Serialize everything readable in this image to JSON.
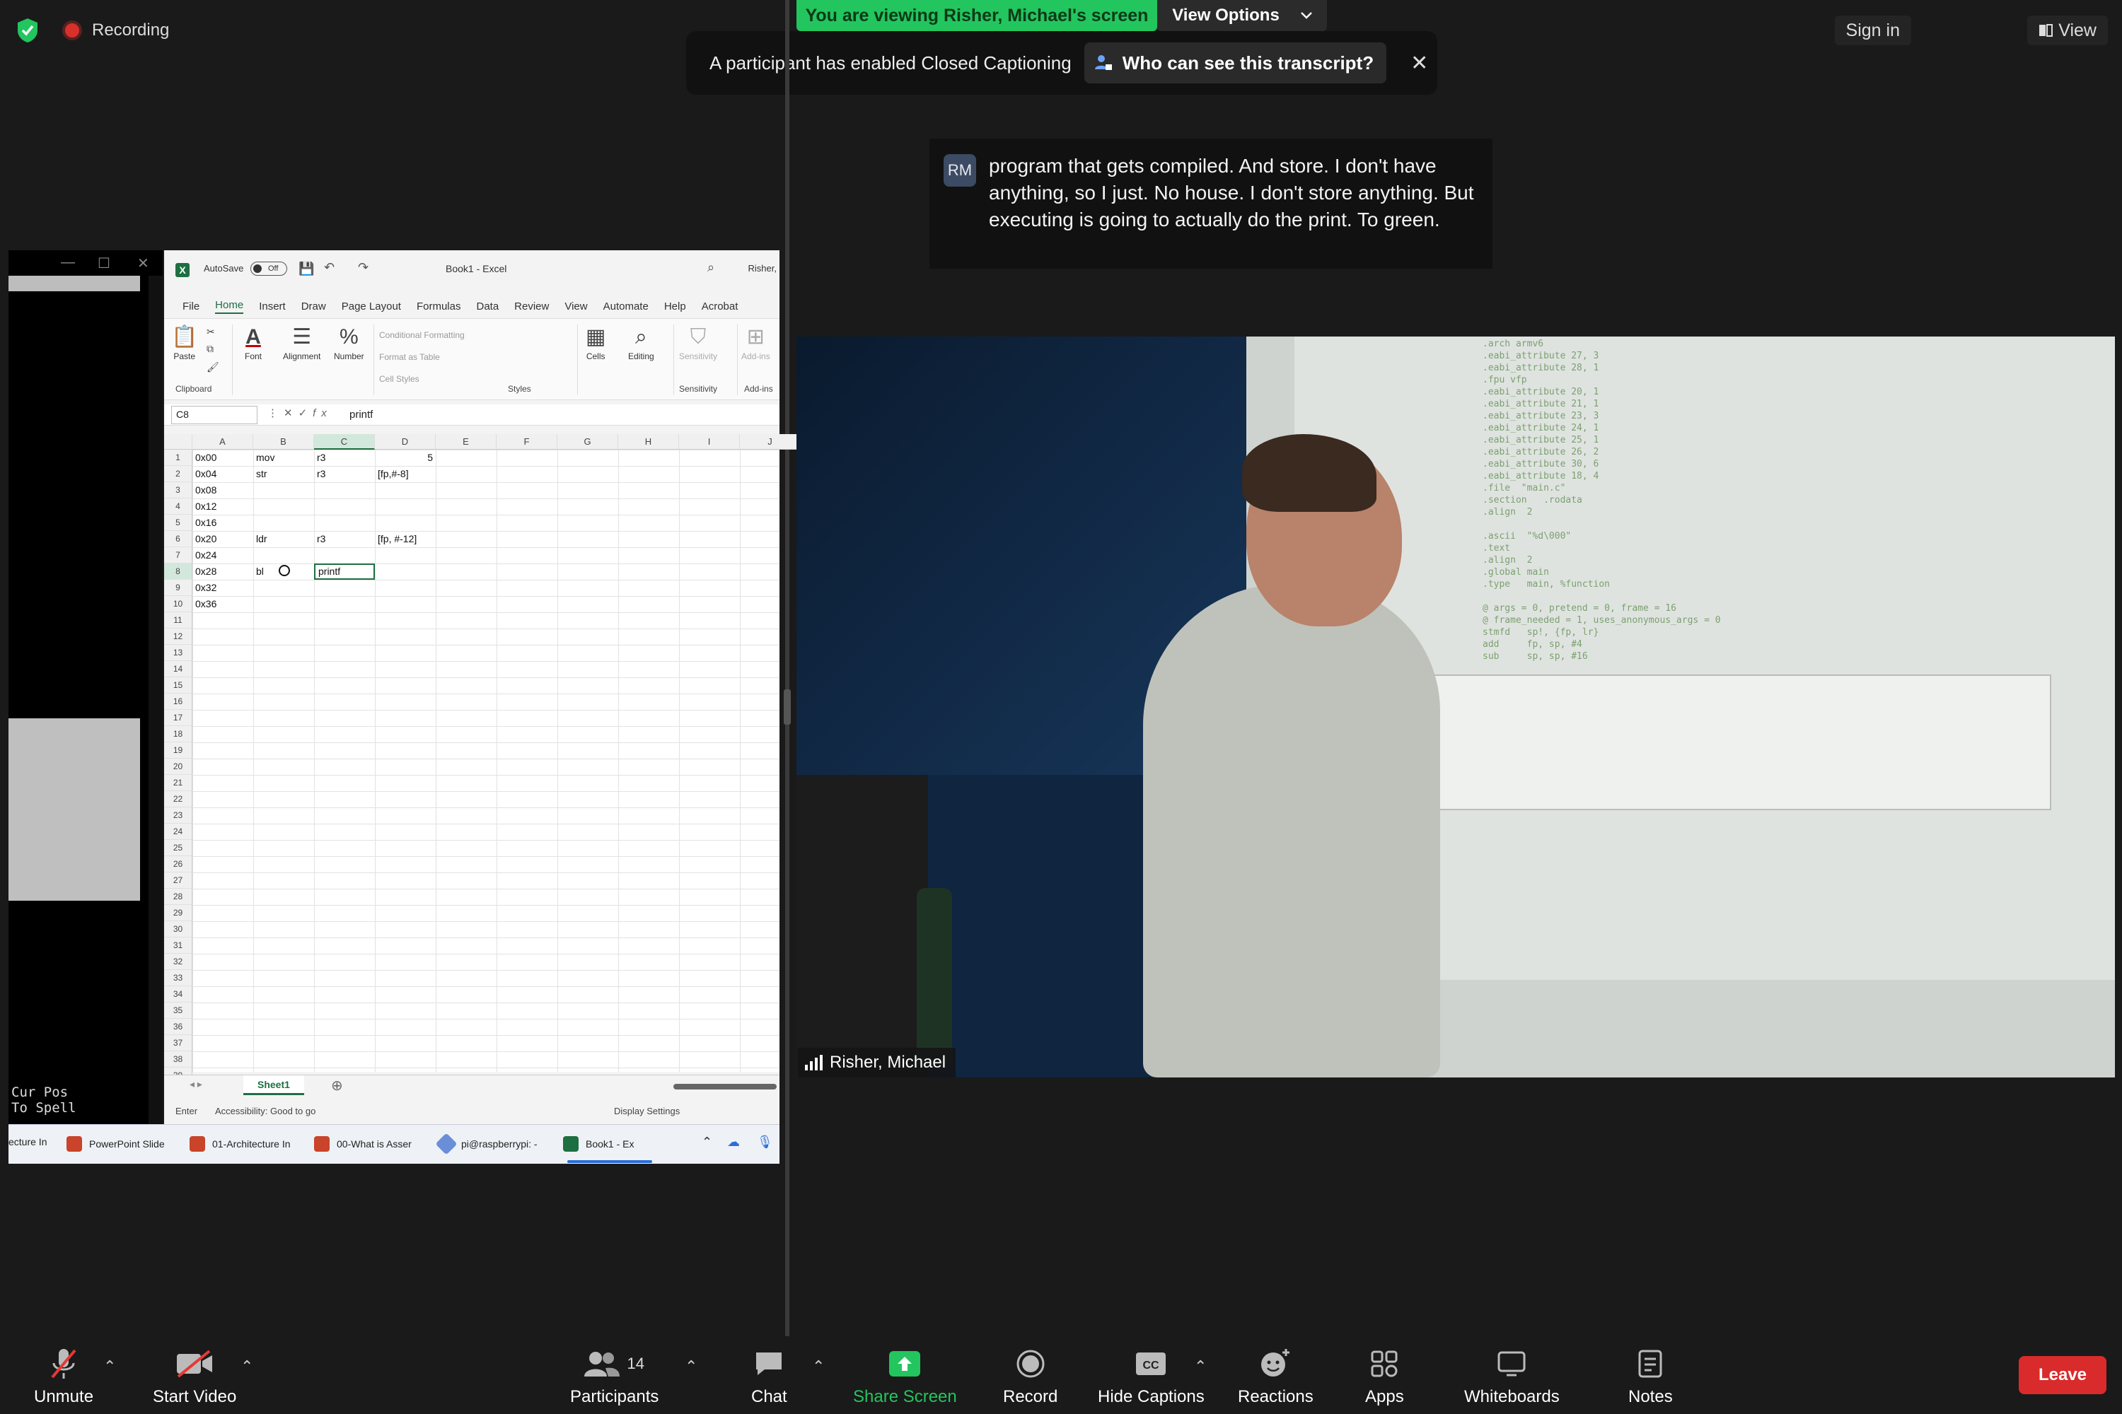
{
  "topbar": {
    "recording_label": "Recording",
    "viewing_label": "You are viewing Risher, Michael's screen",
    "view_options_label": "View Options",
    "sign_in_label": "Sign in",
    "view_label": "View"
  },
  "cc_banner": {
    "message": "A participant has enabled Closed Captioning",
    "who_label": "Who can see this transcript?"
  },
  "caption": {
    "speaker_initials": "RM",
    "text": "program that gets compiled. And store. I don't have anything, so I just. No house. I don't store anything. But executing is going to actually do the print. To green."
  },
  "terminal": {
    "bottom_text": "Cur Pos\nTo Spell"
  },
  "excel": {
    "autosave_label": "AutoSave",
    "autosave_state": "Off",
    "doc_name": "Book1  -  Excel",
    "user_label": "Risher,",
    "menu": [
      "File",
      "Home",
      "Insert",
      "Draw",
      "Page Layout",
      "Formulas",
      "Data",
      "Review",
      "View",
      "Automate",
      "Help",
      "Acrobat"
    ],
    "ribbon": {
      "paste": "Paste",
      "clipboard": "Clipboard",
      "font": "Font",
      "alignment": "Alignment",
      "number": "Number",
      "conditional_formatting": "Conditional Formatting",
      "format_as_table": "Format as Table",
      "cell_styles": "Cell Styles",
      "styles": "Styles",
      "cells": "Cells",
      "editing": "Editing",
      "sensitivity_btn": "Sensitivity",
      "sensitivity": "Sensitivity",
      "addins_btn": "Add-ins",
      "addins": "Add-ins"
    },
    "name_box": "C8",
    "formula_value": "printf",
    "columns": [
      "A",
      "B",
      "C",
      "D",
      "E",
      "F",
      "G",
      "H",
      "I",
      "J"
    ],
    "row_count": 39,
    "cells": {
      "A1": "0x00",
      "B1": "mov",
      "C1": "r3",
      "D1": "5",
      "A2": "0x04",
      "B2": "str",
      "C2": "r3",
      "D2": "[fp,#-8]",
      "A3": "0x08",
      "A4": "0x12",
      "A5": "0x16",
      "A6": "0x20",
      "B6": "ldr",
      "C6": "r3",
      "D6": "[fp, #-12]",
      "A7": "0x24",
      "A8": "0x28",
      "B8": "bl",
      "C8": "printf",
      "A9": "0x32",
      "A10": "0x36"
    },
    "sheet_tab": "Sheet1",
    "status_mode": "Enter",
    "accessibility": "Accessibility: Good to go",
    "display_settings": "Display Settings"
  },
  "taskbar": {
    "items": [
      "ecture In",
      "PowerPoint Slide",
      "01-Architecture In",
      "00-What is Asser",
      "pi@raspberrypi: -",
      "Book1 - Ex"
    ]
  },
  "video": {
    "participant_name": "Risher, Michael"
  },
  "toolbar": {
    "unmute": "Unmute",
    "start_video": "Start Video",
    "participants": "Participants",
    "participants_count": "14",
    "chat": "Chat",
    "share_screen": "Share Screen",
    "record": "Record",
    "hide_captions": "Hide Captions",
    "reactions": "Reactions",
    "apps": "Apps",
    "whiteboards": "Whiteboards",
    "notes": "Notes",
    "leave": "Leave"
  },
  "colors": {
    "share_green": "#23c55e",
    "leave_red": "#d92b2b",
    "excel_green": "#1d6f42",
    "background": "#1a1a1a"
  }
}
